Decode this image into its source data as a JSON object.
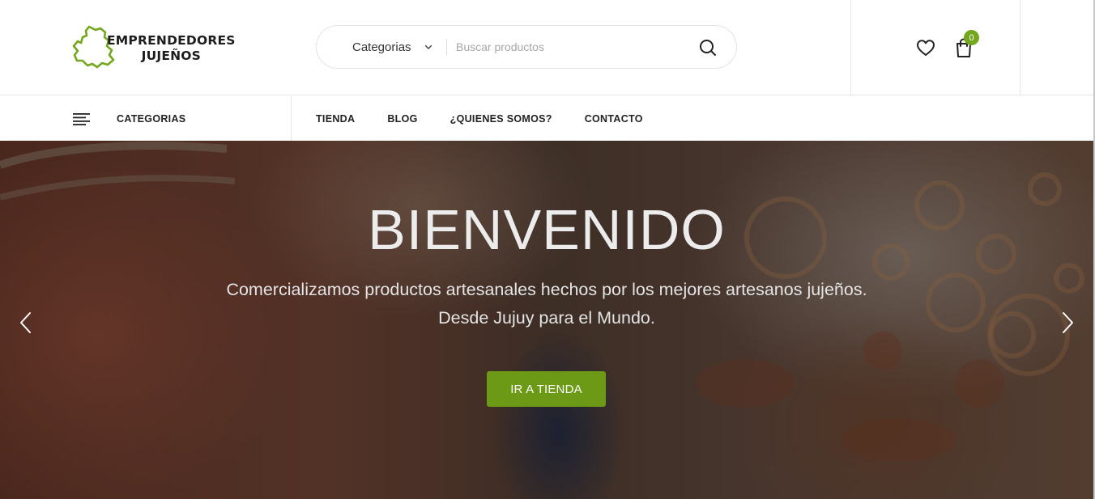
{
  "header": {
    "logo": {
      "line1": "EMPRENDEDORES",
      "line2": "JUJEÑOS"
    },
    "search": {
      "category_label": "Categorias",
      "placeholder": "Buscar productos"
    },
    "cart_count": "0",
    "icons": [
      "heart-icon",
      "shopping-bag-icon",
      "search-icon",
      "chevron-down-icon"
    ]
  },
  "nav": {
    "categories_label": "CATEGORIAS",
    "links": [
      "TIENDA",
      "BLOG",
      "¿QUIENES SOMOS?",
      "CONTACTO"
    ]
  },
  "hero": {
    "title": "BIENVENIDO",
    "subtitle_line1": "Comercializamos productos artesanales hechos por los mejores artesanos jujeños.",
    "subtitle_line2": "Desde Jujuy para el Mundo.",
    "cta_label": "IR A TIENDA"
  },
  "colors": {
    "accent": "#74a61e",
    "button": "#6c9a16",
    "text": "#222222"
  }
}
